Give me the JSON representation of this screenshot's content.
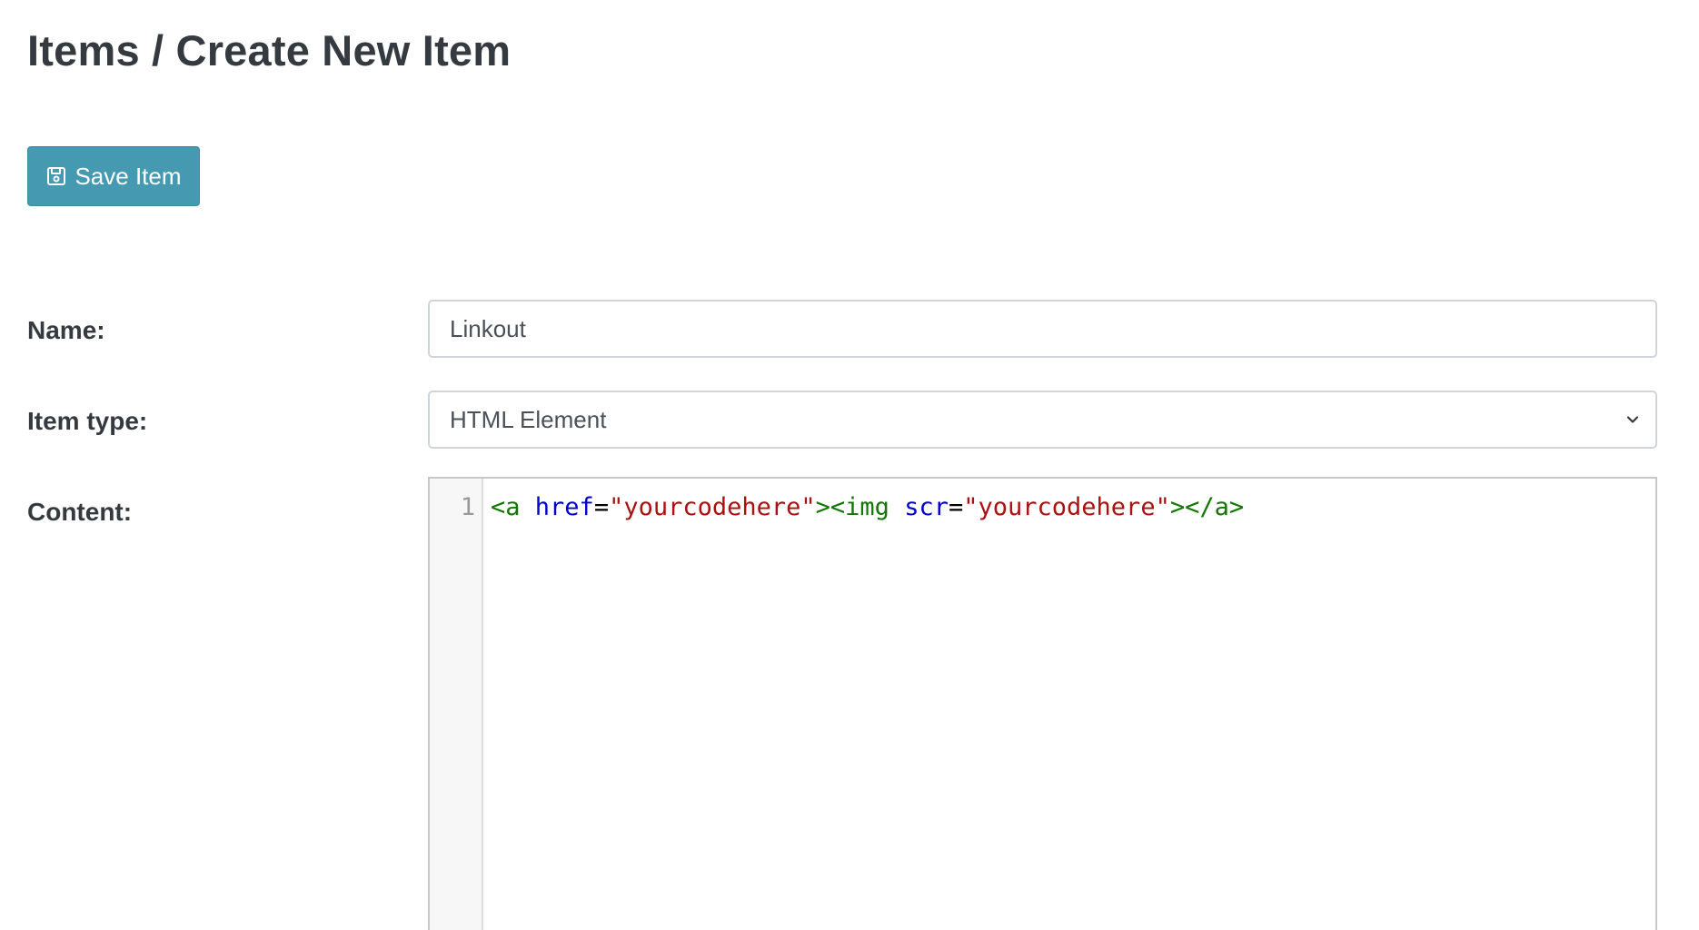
{
  "header": {
    "title": "Items / Create New Item"
  },
  "toolbar": {
    "save_label": "Save Item",
    "save_icon": "floppy-disk-icon"
  },
  "form": {
    "name": {
      "label": "Name:",
      "value": "Linkout"
    },
    "item_type": {
      "label": "Item type:",
      "selected": "HTML Element"
    },
    "content": {
      "label": "Content:",
      "line_numbers": [
        "1"
      ],
      "tokens": [
        {
          "type": "tag",
          "text": "<a"
        },
        {
          "type": "space",
          "text": " "
        },
        {
          "type": "attr",
          "text": "href"
        },
        {
          "type": "eq",
          "text": "="
        },
        {
          "type": "str",
          "text": "\"yourcodehere\""
        },
        {
          "type": "tag",
          "text": "><img"
        },
        {
          "type": "space",
          "text": " "
        },
        {
          "type": "attr",
          "text": "scr"
        },
        {
          "type": "eq",
          "text": "="
        },
        {
          "type": "str",
          "text": "\"yourcodehere\""
        },
        {
          "type": "tag",
          "text": "></a>"
        }
      ]
    }
  },
  "colors": {
    "primary_button": "#4599b0",
    "code_tag": "#117700",
    "code_attr": "#0000cc",
    "code_string": "#aa1111"
  }
}
